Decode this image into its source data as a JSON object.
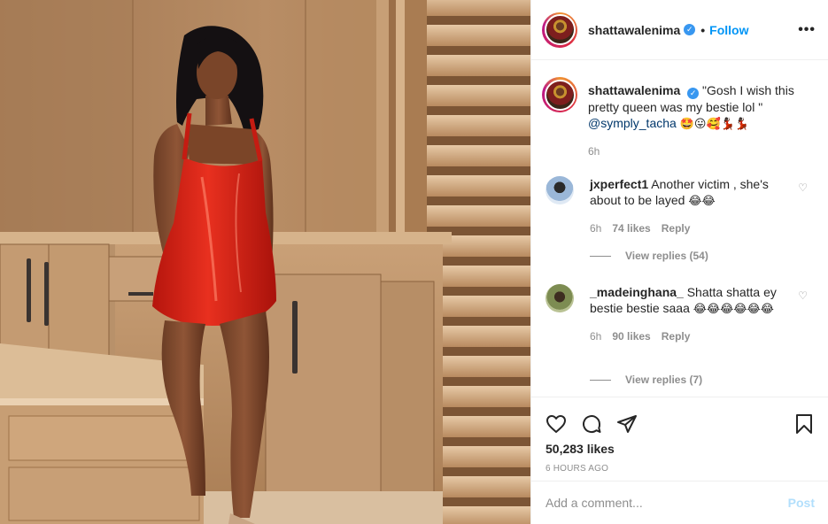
{
  "header": {
    "username": "shattawalenima",
    "verified_icon": "verified-badge-icon",
    "separator": "•",
    "follow_label": "Follow",
    "more_icon": "more-options-icon",
    "more_label": "•••"
  },
  "caption": {
    "username": "shattawalenima",
    "text": "\"Gosh I wish this pretty queen was my bestie lol \"",
    "mention": "@symply_tacha",
    "emojis": "🤩😛🥰💃🏿💃🏿",
    "time": "6h"
  },
  "comments": [
    {
      "username": "jxperfect1",
      "text": "Another victim , she's about to be layed",
      "emojis": "😂😂",
      "time": "6h",
      "likes": "74 likes",
      "reply_label": "Reply",
      "view_replies": "View replies (54)"
    },
    {
      "username": "_madeinghana_",
      "text": "Shatta shatta ey bestie bestie saaa",
      "emojis": "😂😂😂😂😂😂",
      "time": "6h",
      "likes": "90 likes",
      "reply_label": "Reply",
      "view_replies": "View replies (7)"
    }
  ],
  "actions": {
    "like_icon": "heart-icon",
    "comment_icon": "comment-icon",
    "share_icon": "share-icon",
    "save_icon": "bookmark-icon",
    "likes_count": "50,283 likes",
    "timestamp": "6 HOURS AGO"
  },
  "add_comment": {
    "placeholder": "Add a comment...",
    "post_label": "Post"
  },
  "colors": {
    "link_blue": "#0095f6",
    "verified_blue": "#3897f0",
    "muted_gray": "#8e8e8e",
    "post_disabled": "#b2dffc",
    "dress_red": "#d41f14"
  }
}
